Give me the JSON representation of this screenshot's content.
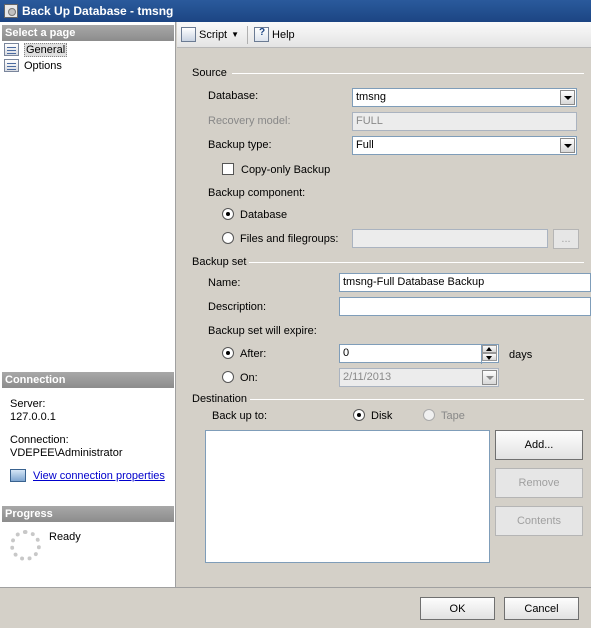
{
  "window": {
    "title": "Back Up Database - tmsng"
  },
  "left_pane": {
    "select_page_header": "Select a page",
    "pages": [
      {
        "label": "General",
        "selected": true
      },
      {
        "label": "Options",
        "selected": false
      }
    ],
    "connection_header": "Connection",
    "server_label": "Server:",
    "server_value": "127.0.0.1",
    "connection_label": "Connection:",
    "connection_value": "VDEPEE\\Administrator",
    "view_connection_link": "View connection properties",
    "progress_header": "Progress",
    "progress_status": "Ready"
  },
  "toolbar": {
    "script_label": "Script",
    "help_label": "Help"
  },
  "source": {
    "header": "Source",
    "database_label": "Database:",
    "database_value": "tmsng",
    "recovery_model_label": "Recovery model:",
    "recovery_model_value": "FULL",
    "backup_type_label": "Backup type:",
    "backup_type_value": "Full",
    "copy_only_label": "Copy-only Backup",
    "backup_component_label": "Backup component:",
    "component_database_label": "Database",
    "component_files_label": "Files and filegroups:",
    "browse_label": "..."
  },
  "backup_set": {
    "header": "Backup set",
    "name_label": "Name:",
    "name_value": "tmsng-Full Database Backup",
    "description_label": "Description:",
    "description_value": "",
    "expire_label": "Backup set will expire:",
    "after_label": "After:",
    "after_value": "0",
    "days_label": "days",
    "on_label": "On:",
    "on_value": "2/11/2013"
  },
  "destination": {
    "header": "Destination",
    "back_up_to_label": "Back up to:",
    "disk_label": "Disk",
    "tape_label": "Tape",
    "add_label": "Add...",
    "remove_label": "Remove",
    "contents_label": "Contents"
  },
  "dialog": {
    "ok_label": "OK",
    "cancel_label": "Cancel"
  }
}
